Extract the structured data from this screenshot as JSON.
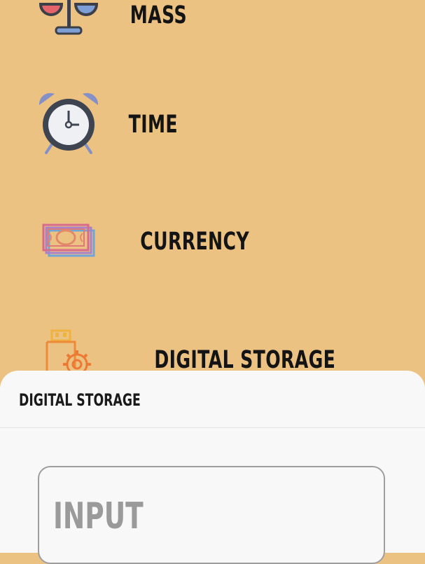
{
  "menu": {
    "items": [
      {
        "label": "MASS",
        "icon": "scale-icon"
      },
      {
        "label": "TIME",
        "icon": "alarm-clock-icon"
      },
      {
        "label": "CURRENCY",
        "icon": "banknotes-icon"
      },
      {
        "label": "DIGITAL STORAGE",
        "icon": "usb-drive-gear-icon"
      }
    ]
  },
  "sheet": {
    "title": "DIGITAL STORAGE",
    "input_placeholder": "INPUT"
  },
  "colors": {
    "background": "#ecc283",
    "sheet": "#f8f8f8",
    "label_text": "#141414",
    "placeholder": "#9a9a9a"
  }
}
